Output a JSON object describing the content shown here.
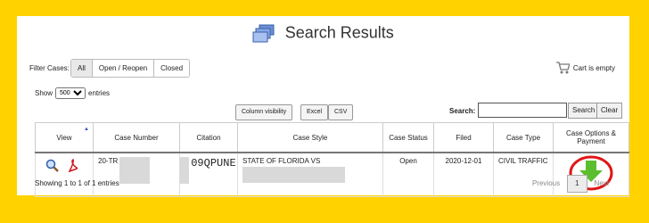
{
  "header": {
    "title": "Search Results"
  },
  "filter": {
    "label": "Filter Cases:",
    "options": [
      "All",
      "Open / Reopen",
      "Closed"
    ],
    "selected": "All"
  },
  "cart": {
    "text": "Cart is empty"
  },
  "show": {
    "prefix": "Show",
    "value": "500",
    "suffix": "entries"
  },
  "toolbar": {
    "column_visibility": "Column visibility",
    "excel": "Excel",
    "csv": "CSV"
  },
  "search": {
    "label": "Search:",
    "value": "",
    "search_btn": "Search",
    "clear_btn": "Clear"
  },
  "table": {
    "columns": [
      "View",
      "Case Number",
      "Citation",
      "Case Style",
      "Case Status",
      "Filed",
      "Case Type",
      "Case Options & Payment"
    ],
    "rows": [
      {
        "case_number": "20-TR",
        "citation": "09QPUNE",
        "case_style": "STATE OF FLORIDA VS",
        "status": "Open",
        "filed": "2020-12-01",
        "case_type": "CIVIL TRAFFIC"
      }
    ]
  },
  "footer": {
    "info": "Showing 1 to 1 of 1 entries",
    "previous": "Previous",
    "page": "1",
    "next": "Next"
  },
  "colors": {
    "background": "#FFD200",
    "accent_green": "#5BBE2E",
    "highlight_circle": "#E01616"
  }
}
